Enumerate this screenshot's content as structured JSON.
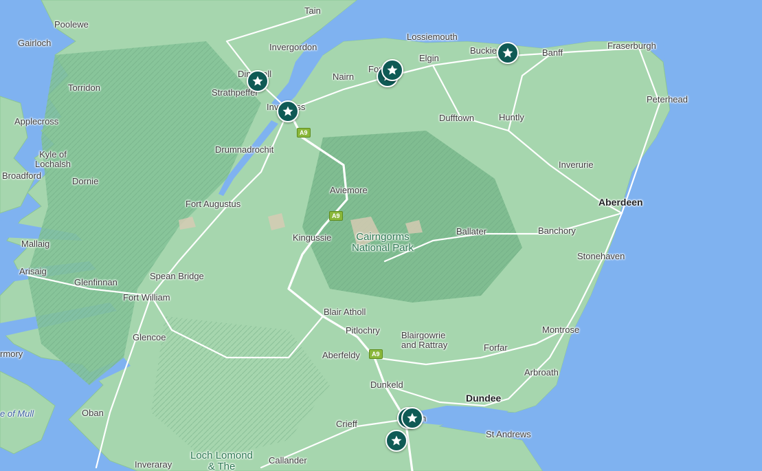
{
  "map": {
    "colors": {
      "sea": "#7fb2f0",
      "land": "#9fd0a6",
      "highland": "#7fbf92",
      "road": "#ffffff",
      "marker": "#0f5a55"
    },
    "towns": [
      {
        "id": "tain",
        "name": "Tain"
      },
      {
        "id": "poolewe",
        "name": "Poolewe"
      },
      {
        "id": "lossiemouth",
        "name": "Lossiemouth"
      },
      {
        "id": "gairloch",
        "name": "Gairloch"
      },
      {
        "id": "invergordon",
        "name": "Invergordon"
      },
      {
        "id": "buckie",
        "name": "Buckie"
      },
      {
        "id": "banff",
        "name": "Banff"
      },
      {
        "id": "fraserburgh",
        "name": "Fraserburgh"
      },
      {
        "id": "elgin",
        "name": "Elgin"
      },
      {
        "id": "dingwall",
        "name": "Dingwall"
      },
      {
        "id": "forres",
        "name": "Forres"
      },
      {
        "id": "nairn",
        "name": "Nairn"
      },
      {
        "id": "strathpeffer",
        "name": "Strathpeffer"
      },
      {
        "id": "torridon",
        "name": "Torridon"
      },
      {
        "id": "peterhead",
        "name": "Peterhead"
      },
      {
        "id": "inverness",
        "name": "Inverness"
      },
      {
        "id": "dufftown",
        "name": "Dufftown"
      },
      {
        "id": "huntly",
        "name": "Huntly"
      },
      {
        "id": "applecross",
        "name": "Applecross"
      },
      {
        "id": "drumnadrochit",
        "name": "Drumnadrochit"
      },
      {
        "id": "kyle",
        "name": "Kyle of\nLochalsh"
      },
      {
        "id": "inverurie",
        "name": "Inverurie"
      },
      {
        "id": "broadford",
        "name": "Broadford"
      },
      {
        "id": "dornie",
        "name": "Dornie"
      },
      {
        "id": "aviemore",
        "name": "Aviemore"
      },
      {
        "id": "aberdeen",
        "name": "Aberdeen"
      },
      {
        "id": "fortaugustus",
        "name": "Fort Augustus"
      },
      {
        "id": "ballater",
        "name": "Ballater"
      },
      {
        "id": "banchory",
        "name": "Banchory"
      },
      {
        "id": "kingussie",
        "name": "Kingussie"
      },
      {
        "id": "mallaig",
        "name": "Mallaig"
      },
      {
        "id": "stonehaven",
        "name": "Stonehaven"
      },
      {
        "id": "arisaig",
        "name": "Arisaig"
      },
      {
        "id": "speanbridge",
        "name": "Spean Bridge"
      },
      {
        "id": "glenfinnan",
        "name": "Glenfinnan"
      },
      {
        "id": "fortwilliam",
        "name": "Fort William"
      },
      {
        "id": "blairatholl",
        "name": "Blair Atholl"
      },
      {
        "id": "montrose",
        "name": "Montrose"
      },
      {
        "id": "pitlochry",
        "name": "Pitlochry"
      },
      {
        "id": "glencoe",
        "name": "Glencoe"
      },
      {
        "id": "forfar",
        "name": "Forfar"
      },
      {
        "id": "tobermory",
        "name": "rmory"
      },
      {
        "id": "blairgowrie",
        "name": "Blairgowrie\nand Rattray"
      },
      {
        "id": "aberfeldy",
        "name": "Aberfeldy"
      },
      {
        "id": "arbroath",
        "name": "Arbroath"
      },
      {
        "id": "dunkeld",
        "name": "Dunkeld"
      },
      {
        "id": "dundee",
        "name": "Dundee"
      },
      {
        "id": "mull",
        "name": "e of Mull"
      },
      {
        "id": "oban",
        "name": "Oban"
      },
      {
        "id": "perth",
        "name": "h"
      },
      {
        "id": "crieff",
        "name": "Crieff"
      },
      {
        "id": "standrews",
        "name": "St Andrews"
      },
      {
        "id": "inveraray",
        "name": "Inveraray"
      },
      {
        "id": "callander",
        "name": "Callander"
      },
      {
        "id": "lochlomond",
        "name": "Loch Lomond\n& The"
      }
    ],
    "park_label": "Cairngorms\nNational Park",
    "road_shields": [
      "A9",
      "A9",
      "A9"
    ],
    "markers": [
      {
        "name": "marker-dingwall",
        "icon": "star-icon"
      },
      {
        "name": "marker-inverness",
        "icon": "star-icon"
      },
      {
        "name": "marker-forres-1",
        "icon": "star-icon"
      },
      {
        "name": "marker-forres-2",
        "icon": "star-icon"
      },
      {
        "name": "marker-buckie",
        "icon": "star-icon"
      },
      {
        "name": "marker-perth-1",
        "icon": "star-icon"
      },
      {
        "name": "marker-perth-2",
        "icon": "star-icon"
      },
      {
        "name": "marker-perth-3",
        "icon": "star-icon"
      }
    ]
  }
}
